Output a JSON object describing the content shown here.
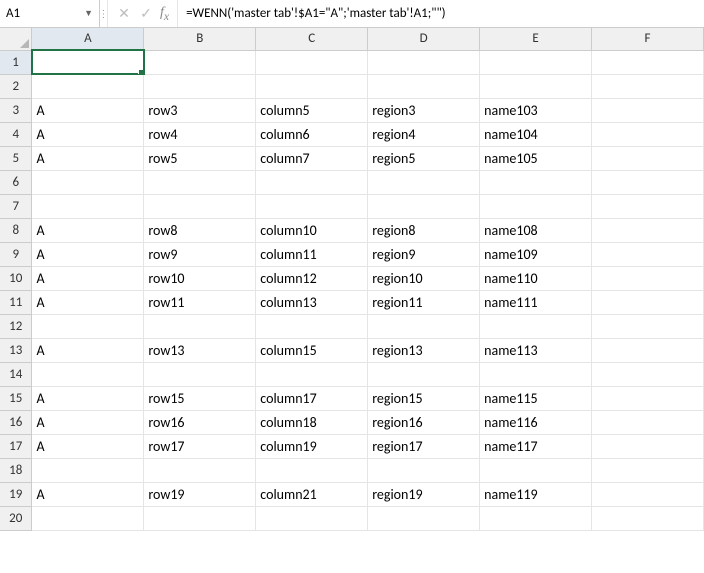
{
  "nameBox": "A1",
  "formula": "=WENN('master tab'!$A1=\"A\";'master tab'!A1;\"\")",
  "columns": [
    "A",
    "B",
    "C",
    "D",
    "E",
    "F"
  ],
  "selected": {
    "col": 0,
    "row": 0
  },
  "rowCount": 20,
  "rows": [
    [
      "",
      "",
      "",
      "",
      "",
      ""
    ],
    [
      "",
      "",
      "",
      "",
      "",
      ""
    ],
    [
      "A",
      "row3",
      "column5",
      "region3",
      "name103",
      ""
    ],
    [
      "A",
      "row4",
      "column6",
      "region4",
      "name104",
      ""
    ],
    [
      "A",
      "row5",
      "column7",
      "region5",
      "name105",
      ""
    ],
    [
      "",
      "",
      "",
      "",
      "",
      ""
    ],
    [
      "",
      "",
      "",
      "",
      "",
      ""
    ],
    [
      "A",
      "row8",
      "column10",
      "region8",
      "name108",
      ""
    ],
    [
      "A",
      "row9",
      "column11",
      "region9",
      "name109",
      ""
    ],
    [
      "A",
      "row10",
      "column12",
      "region10",
      "name110",
      ""
    ],
    [
      "A",
      "row11",
      "column13",
      "region11",
      "name111",
      ""
    ],
    [
      "",
      "",
      "",
      "",
      "",
      ""
    ],
    [
      "A",
      "row13",
      "column15",
      "region13",
      "name113",
      ""
    ],
    [
      "",
      "",
      "",
      "",
      "",
      ""
    ],
    [
      "A",
      "row15",
      "column17",
      "region15",
      "name115",
      ""
    ],
    [
      "A",
      "row16",
      "column18",
      "region16",
      "name116",
      ""
    ],
    [
      "A",
      "row17",
      "column19",
      "region17",
      "name117",
      ""
    ],
    [
      "",
      "",
      "",
      "",
      "",
      ""
    ],
    [
      "A",
      "row19",
      "column21",
      "region19",
      "name119",
      ""
    ],
    [
      "",
      "",
      "",
      "",
      "",
      ""
    ]
  ]
}
